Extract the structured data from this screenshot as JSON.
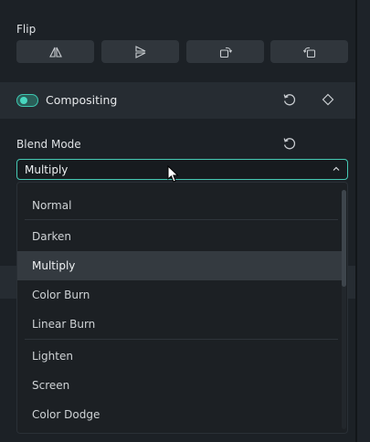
{
  "flip": {
    "label": "Flip",
    "buttons": [
      {
        "icon": "flip-horizontal-icon"
      },
      {
        "icon": "flip-vertical-icon"
      },
      {
        "icon": "rotate-clockwise-icon"
      },
      {
        "icon": "rotate-counterclockwise-icon"
      }
    ]
  },
  "compositing": {
    "label": "Compositing",
    "enabled": true,
    "reset_icon": "reset-icon",
    "keyframe_icon": "keyframe-diamond-icon"
  },
  "blend_mode": {
    "label": "Blend Mode",
    "selected": "Multiply",
    "reset_icon": "reset-icon",
    "options": [
      "Normal",
      "Darken",
      "Multiply",
      "Color Burn",
      "Linear Burn",
      "Lighten",
      "Screen",
      "Color Dodge"
    ]
  },
  "colors": {
    "accent": "#46c9b4",
    "panel": "#1c2126",
    "section_header": "#262c32",
    "selected_row": "#343a40"
  }
}
